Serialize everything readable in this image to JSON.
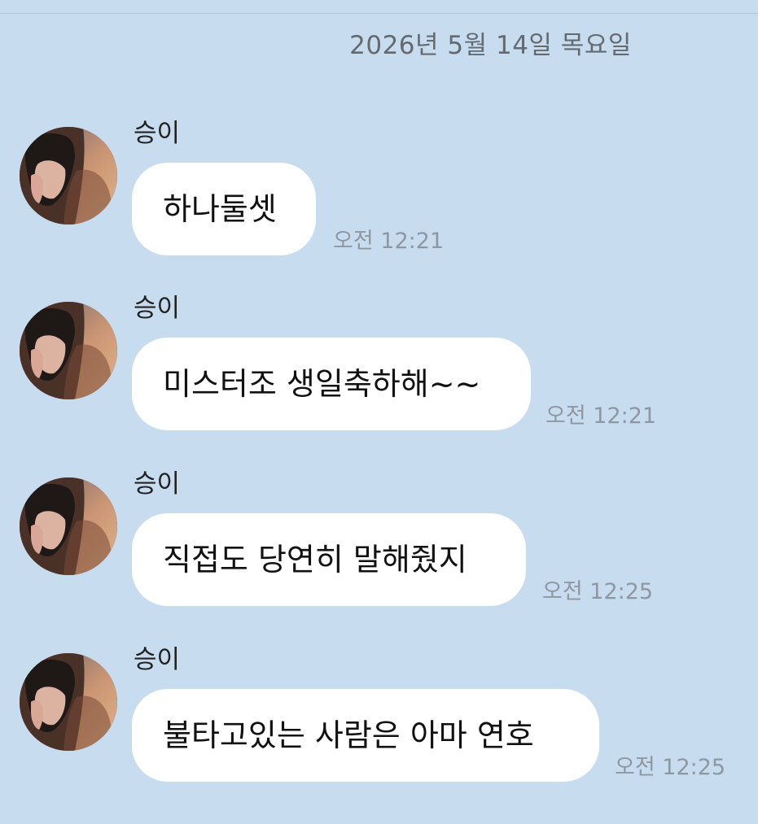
{
  "chat": {
    "date_header": "2026년 5월 14일 목요일",
    "messages": [
      {
        "sender": "승이",
        "text": "하나둘셋",
        "time": "오전 12:21"
      },
      {
        "sender": "승이",
        "text": "미스터조 생일축하해~~",
        "time": "오전 12:21"
      },
      {
        "sender": "승이",
        "text": "직접도 당연히 말해줬지",
        "time": "오전 12:25"
      },
      {
        "sender": "승이",
        "text": "불타고있는 사람은 아마 연호",
        "time": "오전 12:25"
      }
    ]
  },
  "colors": {
    "background": "#c7dcef",
    "bubble": "#ffffff",
    "timestamp": "#8f98a2",
    "date_header": "#646a70"
  },
  "icons": {
    "avatar": "profile-photo"
  }
}
